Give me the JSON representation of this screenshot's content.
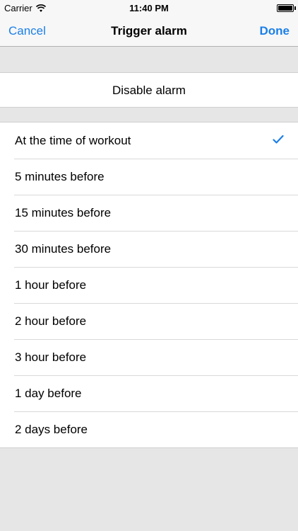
{
  "status_bar": {
    "carrier": "Carrier",
    "time": "11:40 PM",
    "wifi_icon": "wifi-icon",
    "battery_icon": "battery-icon"
  },
  "nav": {
    "cancel_label": "Cancel",
    "title": "Trigger alarm",
    "done_label": "Done",
    "accent_color": "#1b7fe8"
  },
  "disable": {
    "label": "Disable alarm"
  },
  "options": {
    "selected_index": 0,
    "check_icon": "checkmark-icon",
    "items": [
      {
        "label": "At the time of workout"
      },
      {
        "label": "5 minutes before"
      },
      {
        "label": "15 minutes before"
      },
      {
        "label": "30 minutes before"
      },
      {
        "label": "1 hour before"
      },
      {
        "label": "2 hour before"
      },
      {
        "label": "3 hour before"
      },
      {
        "label": "1 day before"
      },
      {
        "label": "2 days before"
      }
    ]
  }
}
